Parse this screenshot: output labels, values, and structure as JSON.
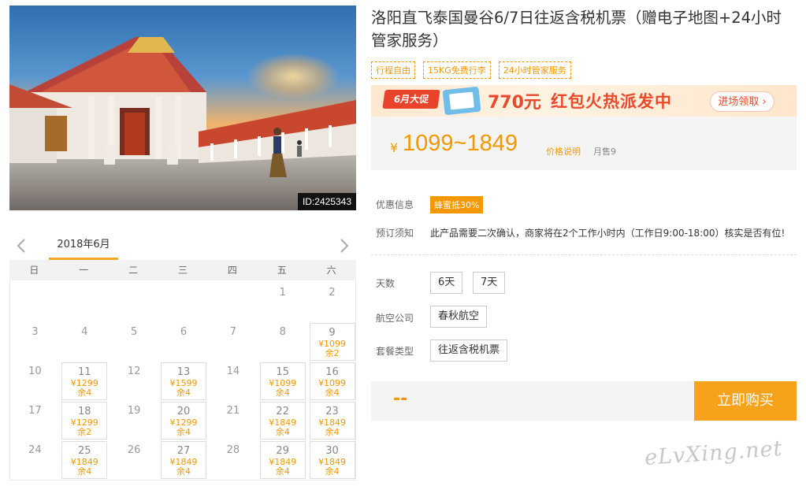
{
  "hero": {
    "id_tag": "ID:2425343"
  },
  "product": {
    "title": "洛阳直飞泰国曼谷6/7日往返含税机票（赠电子地图+24小时管家服务）",
    "tags": [
      "行程自由",
      "15KG免费行李",
      "24小时管家服务"
    ]
  },
  "promo": {
    "label": "6月大促",
    "amount": "770元",
    "text": "红包火热派发中",
    "button": "进场领取 ›"
  },
  "price": {
    "currency": "¥",
    "range": "1099~1849",
    "note": "价格说明",
    "sold": "月售9"
  },
  "info": {
    "discount_label": "优惠信息",
    "discount_badge": "蜂蜜抵30%",
    "notice_label": "预订须知",
    "notice_text": "此产品需要二次确认，商家将在2个工作小时内（工作日9:00-18:00）核实是否有位!"
  },
  "options": {
    "days_label": "天数",
    "days": [
      "6天",
      "7天"
    ],
    "airline_label": "航空公司",
    "airline": "春秋航空",
    "package_label": "套餐类型",
    "package": "往返含税机票"
  },
  "buy": {
    "qty": "--",
    "button": "立即购买"
  },
  "calendar": {
    "month": "2018年6月",
    "weekdays": [
      "日",
      "一",
      "二",
      "三",
      "四",
      "五",
      "六"
    ],
    "days": [
      {
        "d": "1",
        "col": 5,
        "row": 0
      },
      {
        "d": "2",
        "col": 6,
        "row": 0
      },
      {
        "d": "3",
        "col": 0,
        "row": 1
      },
      {
        "d": "4",
        "col": 1,
        "row": 1
      },
      {
        "d": "5",
        "col": 2,
        "row": 1
      },
      {
        "d": "6",
        "col": 3,
        "row": 1
      },
      {
        "d": "7",
        "col": 4,
        "row": 1
      },
      {
        "d": "8",
        "col": 5,
        "row": 1
      },
      {
        "d": "9",
        "col": 6,
        "row": 1,
        "price": "¥1099",
        "stock": "余2"
      },
      {
        "d": "10",
        "col": 0,
        "row": 2
      },
      {
        "d": "11",
        "col": 1,
        "row": 2,
        "price": "¥1299",
        "stock": "余4"
      },
      {
        "d": "12",
        "col": 2,
        "row": 2
      },
      {
        "d": "13",
        "col": 3,
        "row": 2,
        "price": "¥1599",
        "stock": "余4"
      },
      {
        "d": "14",
        "col": 4,
        "row": 2
      },
      {
        "d": "15",
        "col": 5,
        "row": 2,
        "price": "¥1099",
        "stock": "余4"
      },
      {
        "d": "16",
        "col": 6,
        "row": 2,
        "price": "¥1099",
        "stock": "余4"
      },
      {
        "d": "17",
        "col": 0,
        "row": 3
      },
      {
        "d": "18",
        "col": 1,
        "row": 3,
        "price": "¥1299",
        "stock": "余2"
      },
      {
        "d": "19",
        "col": 2,
        "row": 3
      },
      {
        "d": "20",
        "col": 3,
        "row": 3,
        "price": "¥1299",
        "stock": "余4"
      },
      {
        "d": "21",
        "col": 4,
        "row": 3
      },
      {
        "d": "22",
        "col": 5,
        "row": 3,
        "price": "¥1849",
        "stock": "余4"
      },
      {
        "d": "23",
        "col": 6,
        "row": 3,
        "price": "¥1849",
        "stock": "余4"
      },
      {
        "d": "24",
        "col": 0,
        "row": 4
      },
      {
        "d": "25",
        "col": 1,
        "row": 4,
        "price": "¥1849",
        "stock": "余4"
      },
      {
        "d": "26",
        "col": 2,
        "row": 4
      },
      {
        "d": "27",
        "col": 3,
        "row": 4,
        "price": "¥1849",
        "stock": "余4"
      },
      {
        "d": "28",
        "col": 4,
        "row": 4
      },
      {
        "d": "29",
        "col": 5,
        "row": 4,
        "price": "¥1849",
        "stock": "余4"
      },
      {
        "d": "30",
        "col": 6,
        "row": 4,
        "price": "¥1849",
        "stock": "余4"
      }
    ]
  },
  "watermark": "eLvXing.net"
}
